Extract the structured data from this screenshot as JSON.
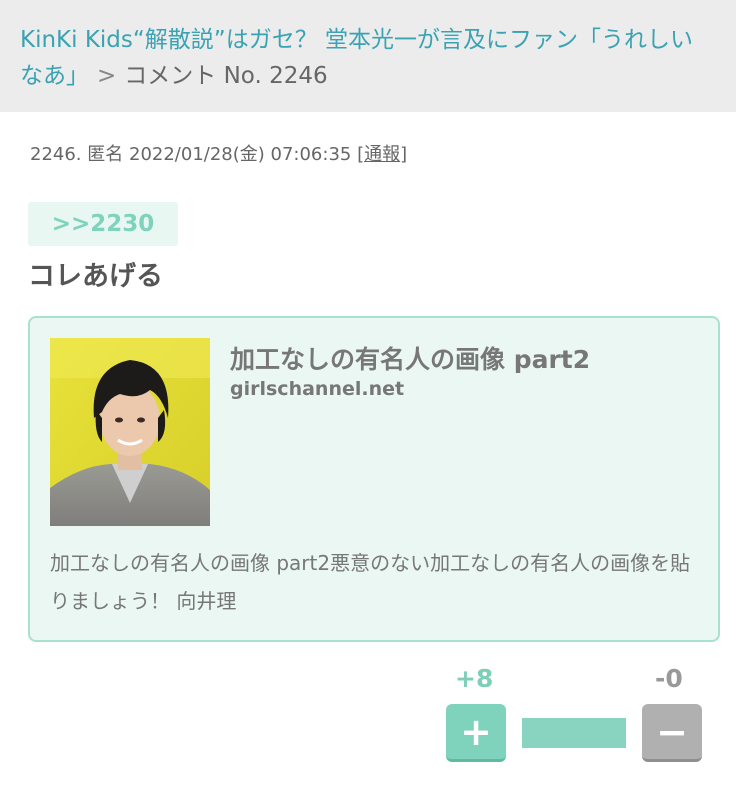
{
  "breadcrumb": {
    "parent_title": "KinKi Kids“解散説”はガセ？ 堂本光一が言及にファン「うれしいなあ」",
    "separator": ">",
    "current": "コメント No. 2246"
  },
  "comment": {
    "number": "2246.",
    "author": "匿名",
    "datetime": "2022/01/28(金) 07:06:35",
    "report_label": "通報",
    "reply_anchor": ">>2230",
    "text": "コレあげる"
  },
  "link_card": {
    "image_icon": "portrait-photo",
    "title": "加工なしの有名人の画像 part2",
    "domain": "girlschannel.net",
    "description": "加工なしの有名人の画像 part2悪意のない加工なしの有名人の画像を貼りましょう！ 向井理"
  },
  "votes": {
    "plus_count": "+8",
    "minus_count": "-0",
    "plus_symbol": "+",
    "minus_symbol": "−",
    "plus_ratio": 1.0,
    "plus_color": "#7fd3bd",
    "minus_color": "#b0b0b0"
  }
}
